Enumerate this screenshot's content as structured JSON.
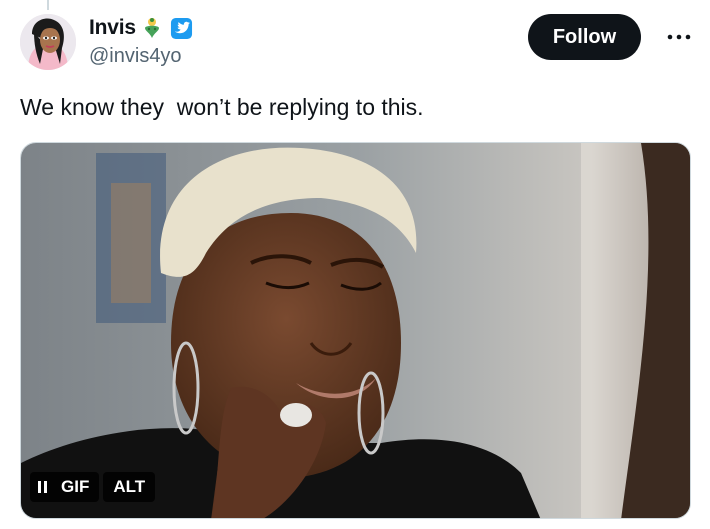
{
  "author": {
    "display_name": "Invis",
    "handle": "@invis4yo",
    "emoji_icon": "genie-emoji",
    "verified_color": "#1d9bf0"
  },
  "follow_button": {
    "label": "Follow"
  },
  "more_menu": {
    "icon": "more-horizontal-icon"
  },
  "tweet": {
    "text": "We know they  won’t be replying to this."
  },
  "media": {
    "type": "gif",
    "gif_label": "GIF",
    "alt_label": "ALT",
    "pause_icon": "pause-icon"
  },
  "colors": {
    "text": "#0f1419",
    "secondary": "#536471",
    "button_bg": "#0f1419",
    "button_text": "#ffffff"
  }
}
